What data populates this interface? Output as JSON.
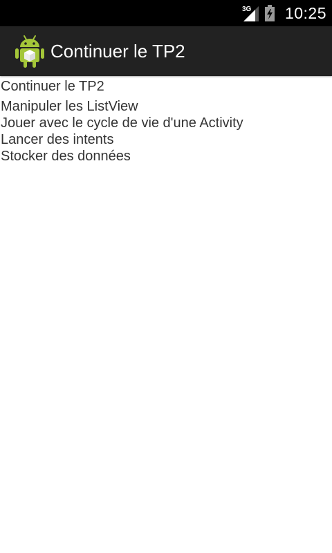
{
  "status_bar": {
    "network": "3G",
    "time": "10:25",
    "signal_icon": "signal-bars-icon",
    "battery_icon": "battery-charging-icon"
  },
  "action_bar": {
    "title": "Continuer le TP2",
    "icon": "android-icon"
  },
  "content": {
    "header": "Continuer le TP2",
    "items": [
      {
        "label": "Manipuler les ListView"
      },
      {
        "label": "Jouer avec le cycle de vie d'une Activity"
      },
      {
        "label": "Lancer des intents"
      },
      {
        "label": "Stocker des données"
      }
    ]
  },
  "colors": {
    "status_bar_bg": "#000000",
    "action_bar_bg": "#222222",
    "android_green": "#A4C639",
    "text": "#333333"
  }
}
